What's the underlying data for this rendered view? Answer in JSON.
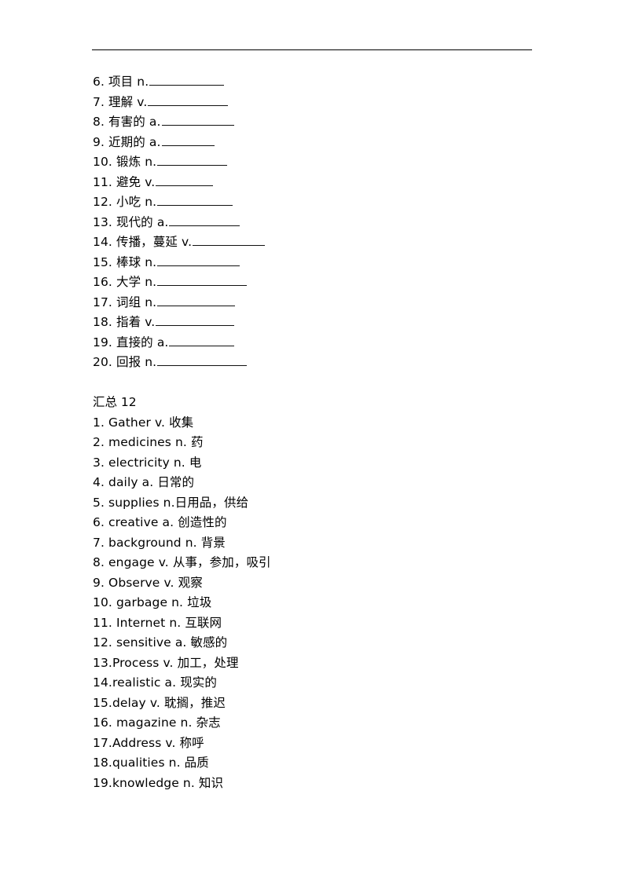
{
  "document": {
    "rule_color": "#000000",
    "text_color": "#000000",
    "background_color": "#ffffff"
  },
  "exercise": {
    "items": [
      {
        "number": "6.",
        "term": "项目",
        "pos": "n.",
        "blank_width": 95
      },
      {
        "number": "7.",
        "term": "理解",
        "pos": "v.",
        "blank_width": 102
      },
      {
        "number": "8.",
        "term": "有害的",
        "pos": "a.",
        "blank_width": 92
      },
      {
        "number": "9.",
        "term": "近期的",
        "pos": "a.",
        "blank_width": 67
      },
      {
        "number": "10.",
        "term": "锻炼",
        "pos": "n.",
        "blank_width": 89
      },
      {
        "number": "11.",
        "term": "避免",
        "pos": "v.",
        "blank_width": 73
      },
      {
        "number": "12.",
        "term": "小吃",
        "pos": "n.",
        "blank_width": 96
      },
      {
        "number": "13.",
        "term": "现代的",
        "pos": "a.",
        "blank_width": 90
      },
      {
        "number": "14.",
        "term": "传播，蔓延",
        "pos": "v.",
        "blank_width": 92
      },
      {
        "number": "15.",
        "term": "棒球",
        "pos": "n.",
        "blank_width": 105
      },
      {
        "number": "16.",
        "term": "大学",
        "pos": "n.",
        "blank_width": 114
      },
      {
        "number": "17.",
        "term": "词组",
        "pos": "n.",
        "blank_width": 99
      },
      {
        "number": "18.",
        "term": "指着",
        "pos": "v.",
        "blank_width": 100
      },
      {
        "number": "19.",
        "term": "直接的",
        "pos": "a.",
        "blank_width": 83
      },
      {
        "number": "20.",
        "term": "回报",
        "pos": "n.",
        "blank_width": 114
      }
    ]
  },
  "answer_key": {
    "title": "汇总 12",
    "entries": [
      {
        "number": "1.",
        "word": "Gather",
        "pos": "v.",
        "meaning": "收集"
      },
      {
        "number": "2.",
        "word": "medicines",
        "pos": "n.",
        "meaning": "药"
      },
      {
        "number": "3.",
        "word": "electricity",
        "pos": "n.",
        "meaning": "电"
      },
      {
        "number": "4.",
        "word": "daily",
        "pos": "a.",
        "meaning": "日常的"
      },
      {
        "number": "5.",
        "word": "supplies",
        "pos": "n.",
        "meaning": "日用品，供给"
      },
      {
        "number": "6.",
        "word": "creative",
        "pos": "a.",
        "meaning": "创造性的"
      },
      {
        "number": "7.",
        "word": "background",
        "pos": "n.",
        "meaning": "背景"
      },
      {
        "number": "8.",
        "word": "engage",
        "pos": "v.",
        "meaning": "从事，参加，吸引"
      },
      {
        "number": "9.",
        "word": "Observe",
        "pos": "v.",
        "meaning": "观察"
      },
      {
        "number": "10.",
        "word": "garbage",
        "pos": "n.",
        "meaning": "垃圾"
      },
      {
        "number": "11.",
        "word": "Internet",
        "pos": "n.",
        "meaning": "互联网"
      },
      {
        "number": "12.",
        "word": "sensitive",
        "pos": "a.",
        "meaning": "敏感的"
      },
      {
        "number": "13.",
        "word": "Process",
        "pos": "v.",
        "meaning": "加工，处理"
      },
      {
        "number": "14.",
        "word": "realistic",
        "pos": "a.",
        "meaning": "现实的"
      },
      {
        "number": "15.",
        "word": "delay",
        "pos": "v.",
        "meaning": "耽搁，推迟"
      },
      {
        "number": "16.",
        "word": "magazine",
        "pos": "n.",
        "meaning": "杂志"
      },
      {
        "number": "17.",
        "word": "Address",
        "pos": "v.",
        "meaning": "称呼"
      },
      {
        "number": "18.",
        "word": "qualities",
        "pos": "n.",
        "meaning": "品质"
      },
      {
        "number": "19.",
        "word": "knowledge",
        "pos": "n.",
        "meaning": "知识"
      }
    ],
    "lines": [
      "1. Gather v. 收集",
      "2. medicines n. 药",
      "3. electricity n. 电",
      "4. daily a. 日常的",
      "5. supplies n.日用品，供给",
      "6. creative a. 创造性的",
      "7. background n. 背景",
      "8. engage v. 从事，参加，吸引",
      "9. Observe v. 观察",
      "10. garbage n. 垃圾",
      "11. Internet n. 互联网",
      "12. sensitive a. 敏感的",
      "13.Process v. 加工，处理",
      "14.realistic a. 现实的",
      "15.delay v. 耽搁，推迟",
      "16. magazine n. 杂志",
      "17.Address v. 称呼",
      "18.qualities n. 品质",
      "19.knowledge n. 知识"
    ]
  }
}
